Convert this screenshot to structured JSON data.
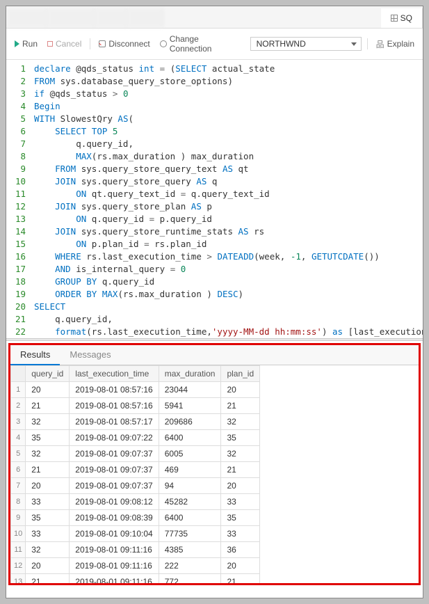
{
  "tabs": {
    "blurred": [
      "",
      "",
      ""
    ],
    "active_prefix_icon": "grid-icon",
    "active_label": "SQ"
  },
  "toolbar": {
    "run": "Run",
    "cancel": "Cancel",
    "disconnect": "Disconnect",
    "change_conn": "Change Connection",
    "connection_value": "NORTHWND",
    "explain": "Explain"
  },
  "code_lines": [
    {
      "n": 1,
      "html": "<span class='kw'>declare</span> @qds_status <span class='kw'>int</span> <span class='op'>=</span> (<span class='kw'>SELECT</span> actual_state"
    },
    {
      "n": 2,
      "html": "<span class='kw'>FROM</span> sys.database_query_store_options)"
    },
    {
      "n": 3,
      "html": "<span class='kw'>if</span> @qds_status <span class='op'>&gt;</span> <span class='num'>0</span>"
    },
    {
      "n": 4,
      "html": "<span class='kw'>Begin</span>"
    },
    {
      "n": 5,
      "html": "<span class='kw'>WITH</span> SlowestQry <span class='kw'>AS</span>("
    },
    {
      "n": 6,
      "html": "    <span class='kw'>SELECT</span> <span class='kw'>TOP</span> <span class='num'>5</span>"
    },
    {
      "n": 7,
      "html": "        q.query_id,"
    },
    {
      "n": 8,
      "html": "        <span class='fn'>MAX</span>(rs.max_duration ) <span class='ident'>max_duration</span>"
    },
    {
      "n": 9,
      "html": "    <span class='kw'>FROM</span> sys.query_store_query_text <span class='kw'>AS</span> qt"
    },
    {
      "n": 10,
      "html": "    <span class='kw'>JOIN</span> sys.query_store_query <span class='kw'>AS</span> q"
    },
    {
      "n": 11,
      "html": "        <span class='kw'>ON</span> qt.query_text_id <span class='op'>=</span> q.query_text_id"
    },
    {
      "n": 12,
      "html": "    <span class='kw'>JOIN</span> sys.query_store_plan <span class='kw'>AS</span> p"
    },
    {
      "n": 13,
      "html": "        <span class='kw'>ON</span> q.query_id <span class='op'>=</span> p.query_id"
    },
    {
      "n": 14,
      "html": "    <span class='kw'>JOIN</span> sys.query_store_runtime_stats <span class='kw'>AS</span> rs"
    },
    {
      "n": 15,
      "html": "        <span class='kw'>ON</span> p.plan_id <span class='op'>=</span> rs.plan_id"
    },
    {
      "n": 16,
      "html": "    <span class='kw'>WHERE</span> rs.last_execution_time <span class='op'>&gt;</span> <span class='fn'>DATEADD</span>(week, <span class='num'>-1</span>, <span class='fn'>GETUTCDATE</span>())"
    },
    {
      "n": 17,
      "html": "    <span class='kw'>AND</span> is_internal_query <span class='op'>=</span> <span class='num'>0</span>"
    },
    {
      "n": 18,
      "html": "    <span class='kw'>GROUP BY</span> q.query_id"
    },
    {
      "n": 19,
      "html": "    <span class='kw'>ORDER BY</span> <span class='fn'>MAX</span>(rs.max_duration ) <span class='kw'>DESC</span>)"
    },
    {
      "n": 20,
      "html": "<span class='kw'>SELECT</span>"
    },
    {
      "n": 21,
      "html": "    q.query_id,"
    },
    {
      "n": 22,
      "html": "    <span class='fn'>format</span>(rs.last_execution_time,<span class='str'>'yyyy-MM-dd hh:mm:ss'</span>) <span class='kw'>as</span> [last_execution_time]"
    }
  ],
  "results": {
    "tabs": {
      "results": "Results",
      "messages": "Messages"
    },
    "columns": [
      "query_id",
      "last_execution_time",
      "max_duration",
      "plan_id"
    ],
    "rows": [
      {
        "n": 1,
        "cells": [
          "20",
          "2019-08-01 08:57:16",
          "23044",
          "20"
        ]
      },
      {
        "n": 2,
        "cells": [
          "21",
          "2019-08-01 08:57:16",
          "5941",
          "21"
        ]
      },
      {
        "n": 3,
        "cells": [
          "32",
          "2019-08-01 08:57:17",
          "209686",
          "32"
        ]
      },
      {
        "n": 4,
        "cells": [
          "35",
          "2019-08-01 09:07:22",
          "6400",
          "35"
        ]
      },
      {
        "n": 5,
        "cells": [
          "32",
          "2019-08-01 09:07:37",
          "6005",
          "32"
        ]
      },
      {
        "n": 6,
        "cells": [
          "21",
          "2019-08-01 09:07:37",
          "469",
          "21"
        ]
      },
      {
        "n": 7,
        "cells": [
          "20",
          "2019-08-01 09:07:37",
          "94",
          "20"
        ]
      },
      {
        "n": 8,
        "cells": [
          "33",
          "2019-08-01 09:08:12",
          "45282",
          "33"
        ]
      },
      {
        "n": 9,
        "cells": [
          "35",
          "2019-08-01 09:08:39",
          "6400",
          "35"
        ]
      },
      {
        "n": 10,
        "cells": [
          "33",
          "2019-08-01 09:10:04",
          "77735",
          "33"
        ]
      },
      {
        "n": 11,
        "cells": [
          "32",
          "2019-08-01 09:11:16",
          "4385",
          "36"
        ]
      },
      {
        "n": 12,
        "cells": [
          "20",
          "2019-08-01 09:11:16",
          "222",
          "20"
        ]
      },
      {
        "n": 13,
        "cells": [
          "21",
          "2019-08-01 09:11:16",
          "772",
          "21"
        ]
      }
    ]
  }
}
